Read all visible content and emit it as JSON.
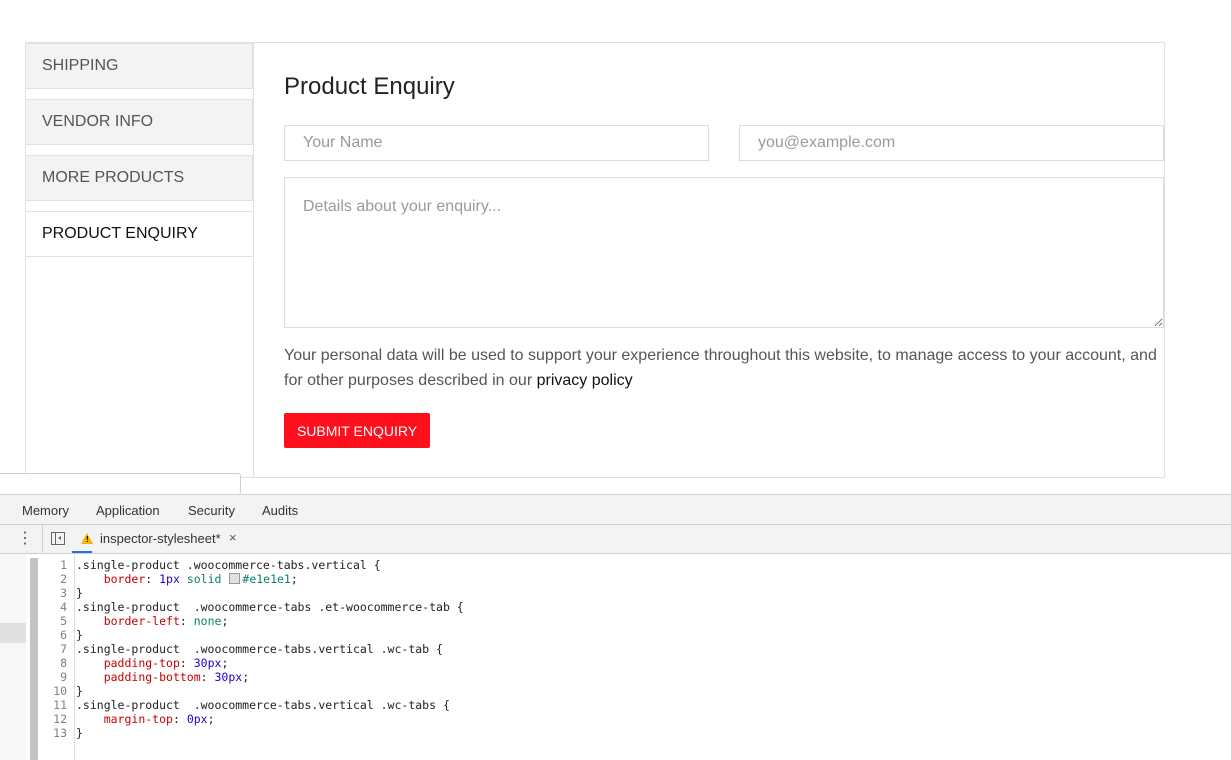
{
  "tabs": [
    {
      "label": "SHIPPING"
    },
    {
      "label": "VENDOR INFO"
    },
    {
      "label": "MORE PRODUCTS"
    },
    {
      "label": "PRODUCT ENQUIRY"
    }
  ],
  "enquiry": {
    "title": "Product Enquiry",
    "name_placeholder": "Your Name",
    "email_placeholder": "you@example.com",
    "details_placeholder": "Details about your enquiry...",
    "privacy_text": "Your personal data will be used to support your experience throughout this website, to manage access to your account, and for other purposes described in our ",
    "privacy_link": "privacy policy",
    "submit_label": "SUBMIT ENQUIRY",
    "submit_color": "#fe0f1e"
  },
  "devtools": {
    "tabs": [
      "Memory",
      "Application",
      "Security",
      "Audits"
    ],
    "file_tab": "inspector-stylesheet*",
    "close_glyph": "×",
    "menu_glyph": "⋮",
    "warning_glyph": "!",
    "code_lines": [
      {
        "n": "1",
        "parts": [
          {
            "t": ".single-product .woocommerce-tabs.vertical {"
          }
        ]
      },
      {
        "n": "2",
        "parts": [
          {
            "t": "    "
          },
          {
            "t": "border",
            "c": "prop"
          },
          {
            "t": ": "
          },
          {
            "t": "1px",
            "c": "num"
          },
          {
            "t": " "
          },
          {
            "t": "solid",
            "c": "kw"
          },
          {
            "t": " "
          },
          {
            "swatch": "#e1e1e1"
          },
          {
            "t": "#e1e1e1",
            "c": "kw"
          },
          {
            "t": ";"
          }
        ]
      },
      {
        "n": "3",
        "parts": [
          {
            "t": "}"
          }
        ]
      },
      {
        "n": "4",
        "parts": [
          {
            "t": ".single-product  .woocommerce-tabs .et-woocommerce-tab {"
          }
        ]
      },
      {
        "n": "5",
        "parts": [
          {
            "t": "    "
          },
          {
            "t": "border-left",
            "c": "prop"
          },
          {
            "t": ": "
          },
          {
            "t": "none",
            "c": "kw"
          },
          {
            "t": ";"
          }
        ]
      },
      {
        "n": "6",
        "parts": [
          {
            "t": "}"
          }
        ]
      },
      {
        "n": "7",
        "parts": [
          {
            "t": ".single-product  .woocommerce-tabs.vertical .wc-tab {"
          }
        ]
      },
      {
        "n": "8",
        "parts": [
          {
            "t": "    "
          },
          {
            "t": "padding-top",
            "c": "prop"
          },
          {
            "t": ": "
          },
          {
            "t": "30px",
            "c": "num"
          },
          {
            "t": ";"
          }
        ]
      },
      {
        "n": "9",
        "parts": [
          {
            "t": "    "
          },
          {
            "t": "padding-bottom",
            "c": "prop"
          },
          {
            "t": ": "
          },
          {
            "t": "30px",
            "c": "num"
          },
          {
            "t": ";"
          }
        ]
      },
      {
        "n": "10",
        "parts": [
          {
            "t": "}"
          }
        ]
      },
      {
        "n": "11",
        "parts": [
          {
            "t": ".single-product  .woocommerce-tabs.vertical .wc-tabs {"
          }
        ]
      },
      {
        "n": "12",
        "parts": [
          {
            "t": "    "
          },
          {
            "t": "margin-top",
            "c": "prop"
          },
          {
            "t": ": "
          },
          {
            "t": "0px",
            "c": "num"
          },
          {
            "t": ";"
          }
        ]
      },
      {
        "n": "13",
        "parts": [
          {
            "t": "}"
          }
        ]
      }
    ]
  }
}
